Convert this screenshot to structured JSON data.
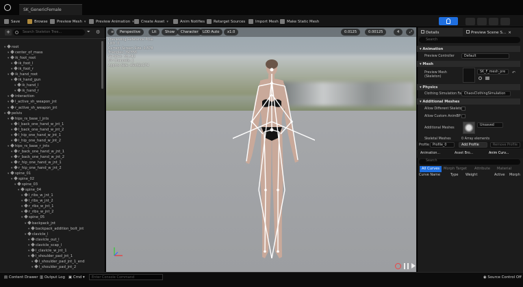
{
  "window": {
    "tab_title": "SK_GenericFemale"
  },
  "toolbar": {
    "save": "Save",
    "browse": "Browse",
    "preview_mesh": "Preview Mesh",
    "preview_animation": "Preview Animation",
    "create_asset": "Create Asset",
    "anim_notifies": "Anim Notifies",
    "retarget_sources": "Retarget Sources",
    "import_mesh": "Import Mesh",
    "make_static_mesh": "Make Static Mesh"
  },
  "skeleton_tree": {
    "search_placeholder": "Search Skeleton Tree...",
    "add": "+",
    "rows": [
      {
        "label": "root",
        "depth": 0
      },
      {
        "label": "center_of_mass",
        "depth": 1
      },
      {
        "label": "ik_foot_root",
        "depth": 1
      },
      {
        "label": "ik_foot_l",
        "depth": 2
      },
      {
        "label": "ik_foot_r",
        "depth": 2
      },
      {
        "label": "ik_hand_root",
        "depth": 1
      },
      {
        "label": "ik_hand_gun",
        "depth": 2
      },
      {
        "label": "ik_hand_l",
        "depth": 3
      },
      {
        "label": "ik_hand_r",
        "depth": 3
      },
      {
        "label": "interaction",
        "depth": 1
      },
      {
        "label": "l_active_sh_weapon_jnt",
        "depth": 1
      },
      {
        "label": "r_active_sh_weapon_jnt",
        "depth": 1
      },
      {
        "label": "pelvis",
        "depth": 0
      },
      {
        "label": "hips_rs_base_l_jnts",
        "depth": 1
      },
      {
        "label": "l_back_one_hand_w_jnt_1",
        "depth": 2
      },
      {
        "label": "l_back_one_hand_w_jnt_2",
        "depth": 2
      },
      {
        "label": "l_hip_one_hand_w_jnt_1",
        "depth": 2
      },
      {
        "label": "l_hip_one_hand_w_jnt_2",
        "depth": 2
      },
      {
        "label": "hips_rs_base_r_jnts",
        "depth": 1
      },
      {
        "label": "r_back_one_hand_w_jnt_1",
        "depth": 2
      },
      {
        "label": "r_back_one_hand_w_jnt_2",
        "depth": 2
      },
      {
        "label": "r_hip_one_hand_w_jnt_1",
        "depth": 2
      },
      {
        "label": "r_hip_one_hand_w_jnt_2",
        "depth": 2
      },
      {
        "label": "spine_01",
        "depth": 1
      },
      {
        "label": "spine_02",
        "depth": 2
      },
      {
        "label": "spine_03",
        "depth": 3
      },
      {
        "label": "spine_04",
        "depth": 4
      },
      {
        "label": "l_ribs_w_jnt_1",
        "depth": 5
      },
      {
        "label": "l_ribs_w_jnt_2",
        "depth": 5
      },
      {
        "label": "r_ribs_w_jnt_1",
        "depth": 5
      },
      {
        "label": "r_ribs_w_jnt_2",
        "depth": 5
      },
      {
        "label": "spine_05",
        "depth": 5
      },
      {
        "label": "backpack_jnt",
        "depth": 6
      },
      {
        "label": "backpack_addition_bolt_jnt",
        "depth": 7
      },
      {
        "label": "clavicle_l",
        "depth": 6
      },
      {
        "label": "clavicle_out_l",
        "depth": 7
      },
      {
        "label": "clavicle_scap_l",
        "depth": 7
      },
      {
        "label": "l_clavicle_w_jnt_1",
        "depth": 7
      },
      {
        "label": "l_shoulder_pad_jnt_1",
        "depth": 7
      },
      {
        "label": "l_shoulder_pad_jnt_1_end",
        "depth": 8
      },
      {
        "label": "l_shoulder_pad_jnt_2",
        "depth": 8
      }
    ]
  },
  "viewport": {
    "perspective": "Perspective",
    "lit": "Lit",
    "show": "Show",
    "character": "Character",
    "lod": "LOD Auto",
    "speed": "x1.0",
    "stat1": "0.0125",
    "stat2": "0.00125",
    "stat3": "4",
    "info": [
      "Previewing Reference Pose",
      "LOD: 0",
      "Current Screen Size: 0.578",
      "Triangles: 39,856",
      "Vertices: 38,342",
      "UV Channels: 1",
      "Approx Size: 49x32x174"
    ]
  },
  "details": {
    "tab_details": "Details",
    "tab_preview": "Preview Scene S...",
    "search_placeholder": "Search",
    "sections": {
      "animation": "Animation",
      "mesh": "Mesh",
      "physics": "Physics",
      "additional": "Additional Meshes"
    },
    "preview_controller_label": "Preview Controller",
    "preview_controller_value": "Default",
    "preview_mesh_label": "Preview Mesh (Skeleton)",
    "preview_mesh_value": "SK_F_mesh_pre",
    "clothing_label": "Clothing Simulation Fact",
    "clothing_value": "ChaosClothingSimulation",
    "allow_diff_label": "Allow Different Skeleton",
    "allow_custom_label": "Allow Custom AnimBP C",
    "additional_meshes_label": "Additional Meshes",
    "additional_meshes_value": "Unsaved",
    "skeletal_meshes_label": "Skeletal Meshes",
    "skeletal_meshes_value": "0 Array elements"
  },
  "profile": {
    "label": "Profile",
    "value": "Profile_0",
    "add": "Add Profile",
    "remove": "Remove Profile"
  },
  "curves": {
    "tabs": [
      "Animation...",
      "Asset Bro...",
      "Anim Curv..."
    ],
    "search_placeholder": "Search",
    "filters": [
      "All Curves",
      "Morph Target",
      "Attribute",
      "Material"
    ],
    "columns": [
      "Curve Name",
      "Type",
      "Weight",
      "Active",
      "Morph"
    ]
  },
  "bottom": {
    "content_drawer": "Content Drawer",
    "output_log": "Output Log",
    "cmd": "Cmd",
    "cmd_placeholder": "Enter Console Command",
    "source_control": "Source Control Off"
  },
  "colors": {
    "accent": "#1f6fe0",
    "panel": "#1c1c1c",
    "bone": "#ffffff"
  }
}
